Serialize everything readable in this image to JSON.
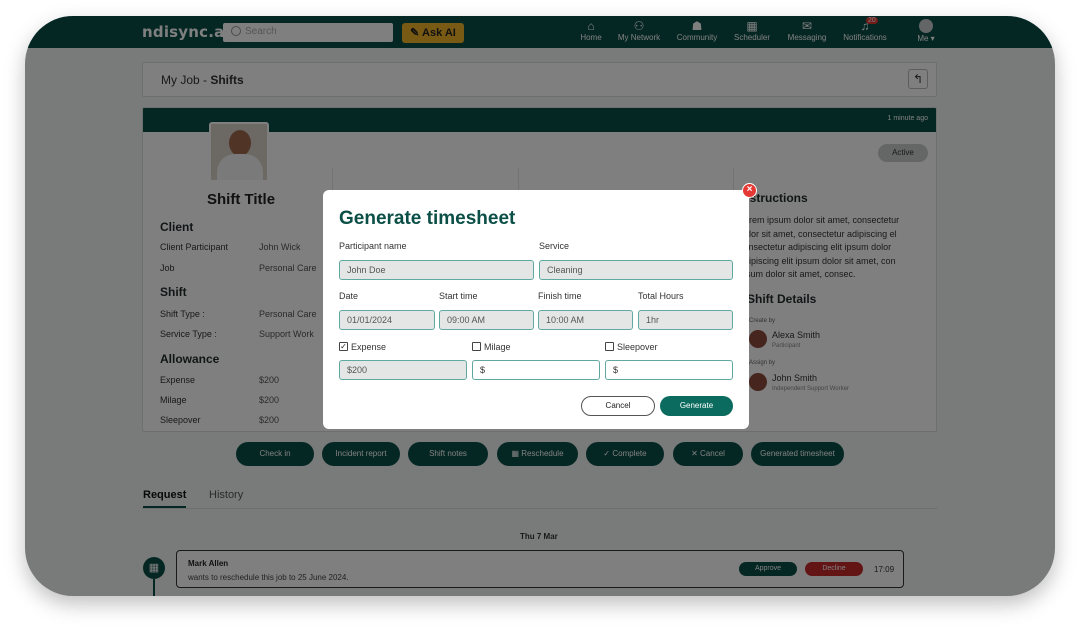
{
  "topbar": {
    "logo": "ndisync.ai",
    "search_placeholder": "Search",
    "ask_ai": "Ask AI",
    "nav": [
      {
        "icon": "home-icon",
        "label": "Home"
      },
      {
        "icon": "network-icon",
        "label": "My Network"
      },
      {
        "icon": "community-icon",
        "label": "Community"
      },
      {
        "icon": "scheduler-icon",
        "label": "Scheduler"
      },
      {
        "icon": "messaging-icon",
        "label": "Messaging"
      },
      {
        "icon": "bell-icon",
        "label": "Notifications",
        "badge": "20"
      },
      {
        "icon": "avatar-icon",
        "label": "Me ▾"
      }
    ]
  },
  "breadcrumb": {
    "prefix": "My Job - ",
    "current": "Shifts"
  },
  "card": {
    "time_ago": "1 minute ago",
    "status": "Active",
    "shift_title": "Shift Title",
    "client_heading": "Client",
    "client_rows": [
      {
        "label": "Client Participant",
        "value": "John Wick"
      },
      {
        "label": "Job",
        "value": "Personal Care"
      }
    ],
    "shift_heading": "Shift",
    "shift_rows": [
      {
        "label": "Shift Type :",
        "value": "Personal Care"
      },
      {
        "label": "Service Type :",
        "value": "Support Work"
      }
    ],
    "allowance_heading": "Allowance",
    "allowance_rows": [
      {
        "label": "Expense",
        "value": "$200"
      },
      {
        "label": "Milage",
        "value": "$200"
      },
      {
        "label": "Sleepover",
        "value": "$200"
      }
    ],
    "instructions_heading": "Instructions",
    "instructions_text": "Lorem ipsum dolor sit amet, consectetur dolor sit amet, consectetur adipiscing el consectetur adipiscing elit  ipsum dolor adipiscing elit  ipsum dolor sit amet, con ipsum dolor sit amet, consec.",
    "shift_details_heading": "Shift Details",
    "created_by_label": "Create by",
    "created_by_name": "Alexa Smith",
    "created_by_role": "Participant",
    "assign_by_label": "Assign by",
    "assign_by_name": "John Smith",
    "assign_by_role": "Independent Support Worker"
  },
  "actions": [
    {
      "label": "Check in",
      "icon": ""
    },
    {
      "label": "Incident report",
      "icon": ""
    },
    {
      "label": "Shift notes",
      "icon": ""
    },
    {
      "label": "Reschedule",
      "icon": "calendar-icon"
    },
    {
      "label": "Complete",
      "icon": "check-icon"
    },
    {
      "label": "Cancel",
      "icon": "close-icon"
    },
    {
      "label": "Generated timesheet",
      "icon": ""
    }
  ],
  "tabs": [
    {
      "label": "Request",
      "active": true
    },
    {
      "label": "History",
      "active": false
    }
  ],
  "timeline": {
    "date": "Thu 7 Mar",
    "item": {
      "name": "Mark Allen",
      "message": "wants to reschedule this job to 25 June 2024.",
      "approve": "Approve",
      "decline": "Decline",
      "time": "17:09"
    }
  },
  "modal": {
    "title": "Generate timesheet",
    "participant_label": "Participant name",
    "participant_value": "John Doe",
    "service_label": "Service",
    "service_value": "Cleaning",
    "date_label": "Date",
    "date_value": "01/01/2024",
    "start_label": "Start time",
    "start_value": "09:00 AM",
    "finish_label": "Finish time",
    "finish_value": "10:00 AM",
    "total_label": "Total Hours",
    "total_value": "1hr",
    "expense_label": "Expense",
    "expense_checked": true,
    "expense_value": "$200",
    "milage_label": "Milage",
    "milage_checked": false,
    "milage_value": "$",
    "sleepover_label": "Sleepover",
    "sleepover_checked": false,
    "sleepover_value": "$",
    "cancel_label": "Cancel",
    "generate_label": "Generate"
  },
  "colors": {
    "primary": "#0b4f47",
    "accent": "#f0b429",
    "danger": "#c62828"
  }
}
